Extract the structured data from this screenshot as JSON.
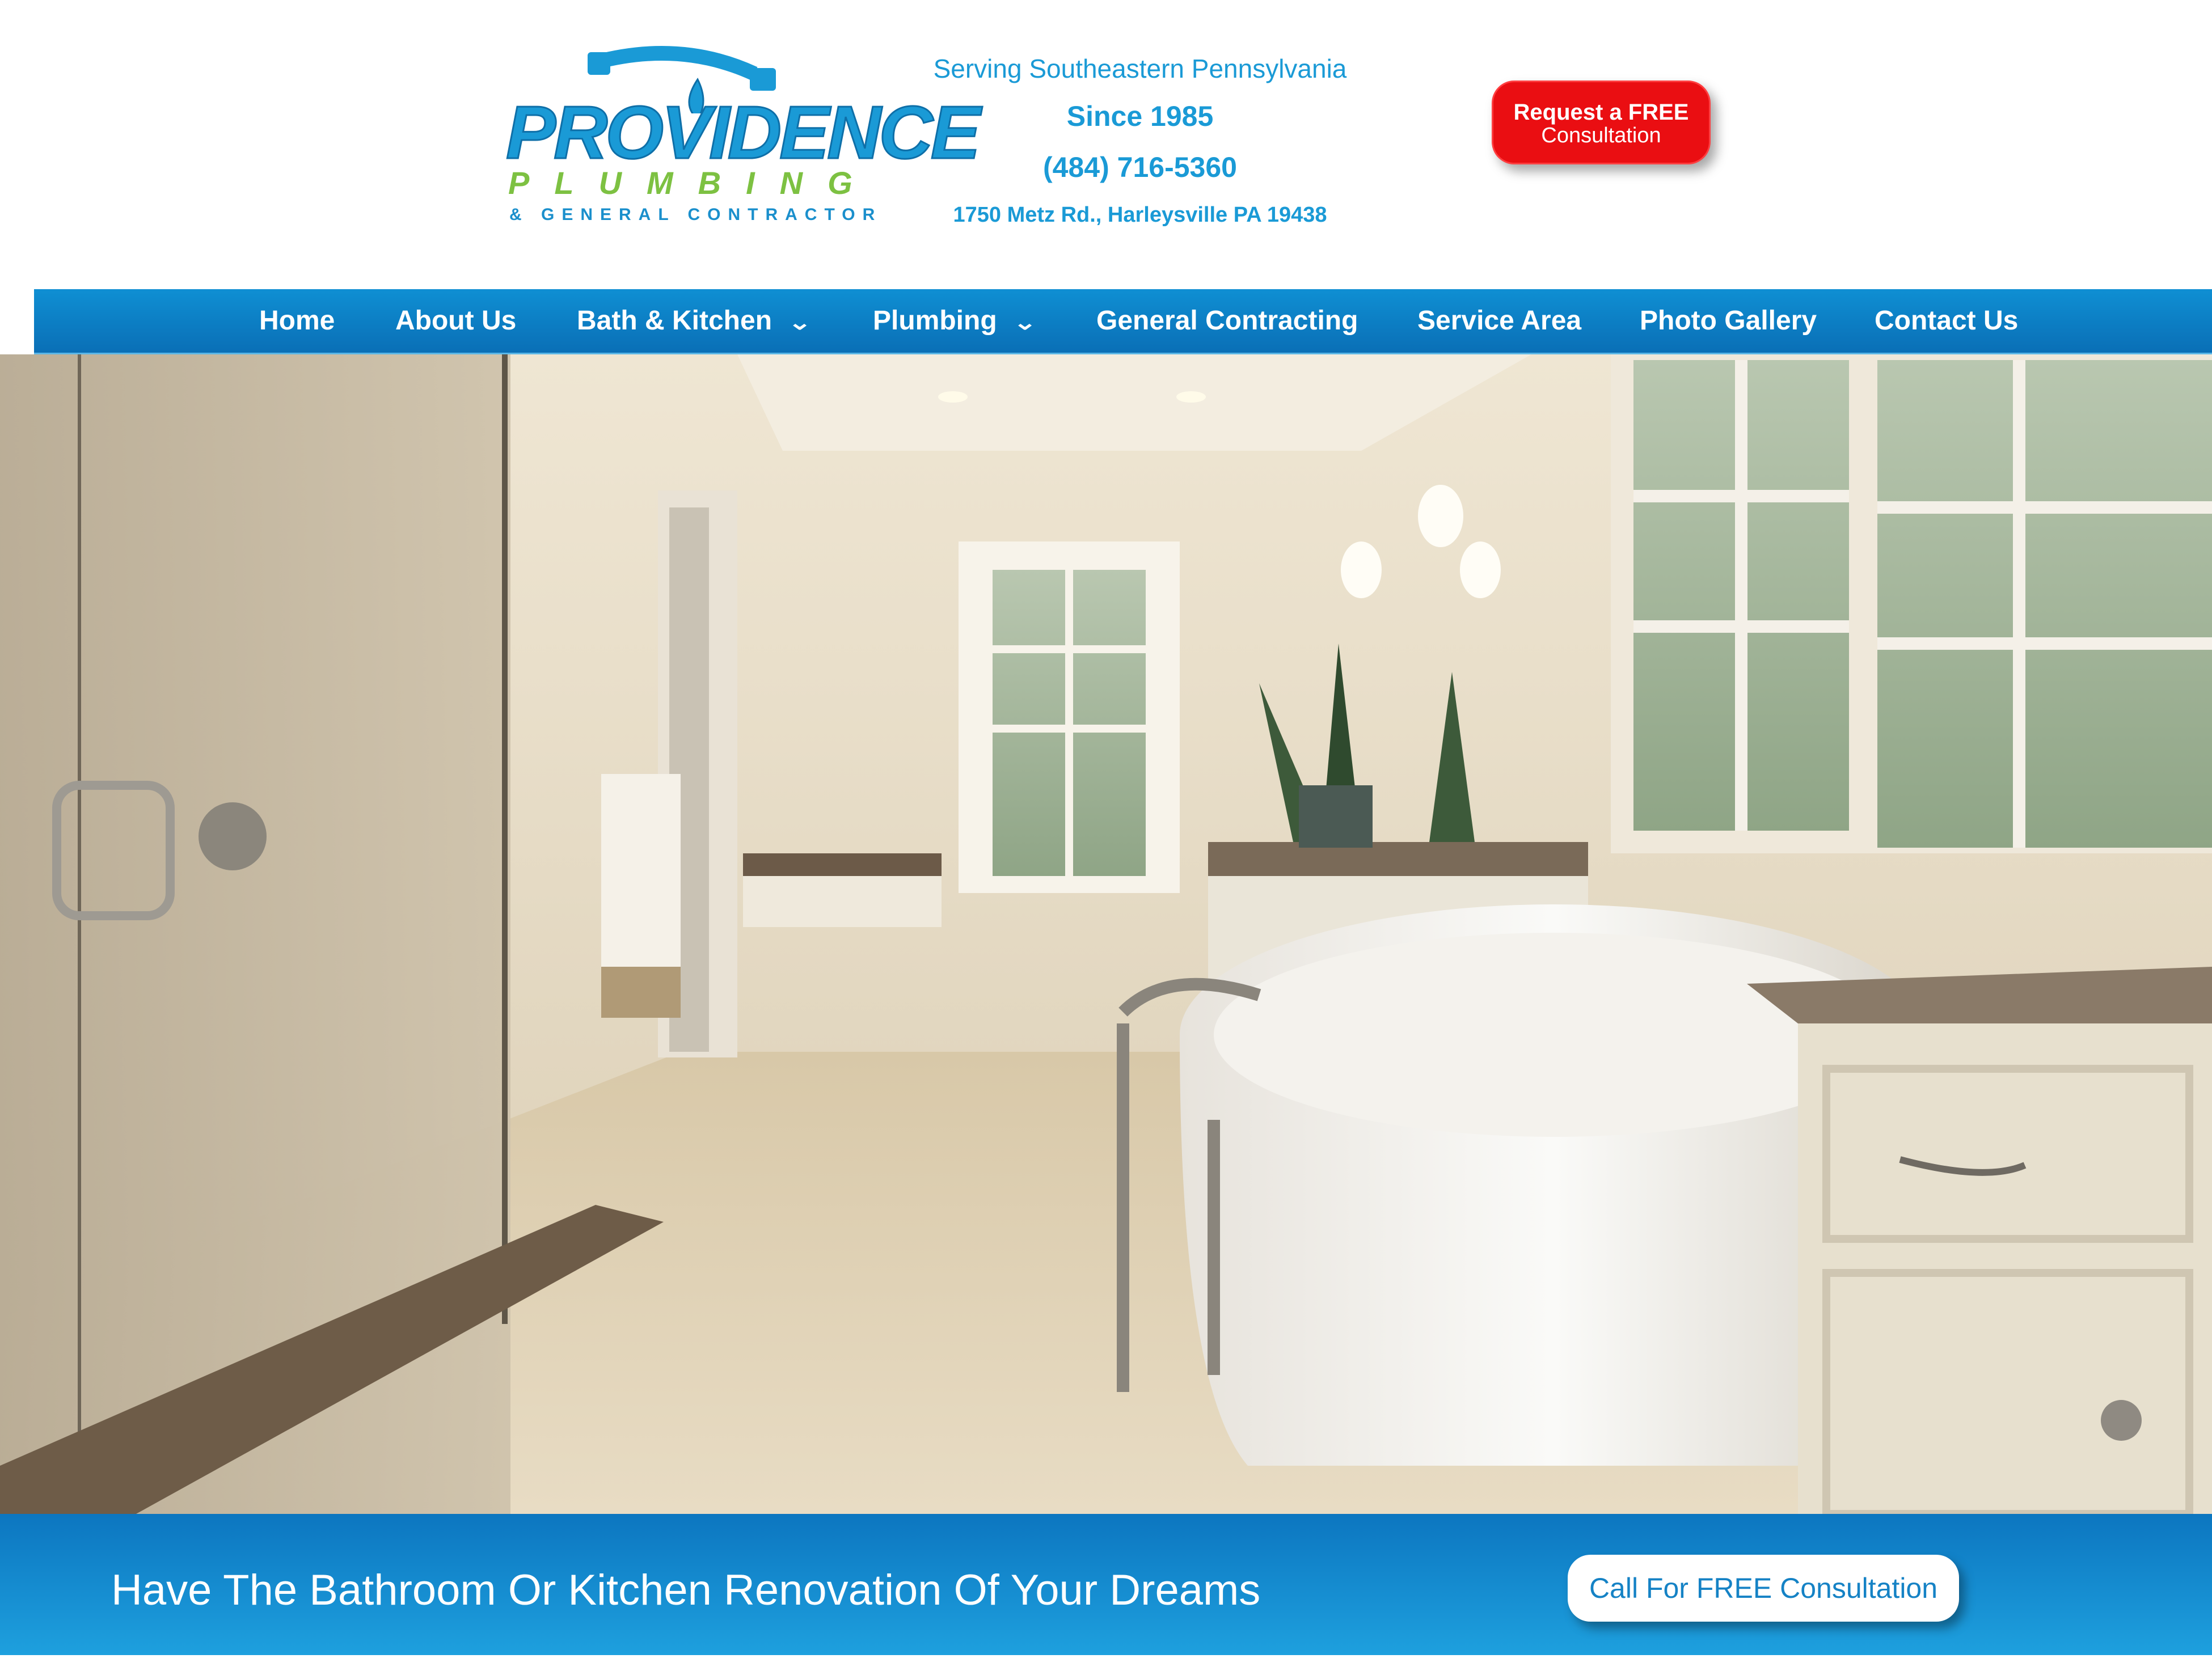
{
  "header": {
    "logo": {
      "word": "PROVIDENCE",
      "sub": "PLUMBING",
      "tagline": "& GENERAL CONTRACTOR"
    },
    "serving": "Serving Southeastern Pennsylvania",
    "since": "Since 1985",
    "phone": "(484) 716-5360",
    "address": "1750 Metz Rd., Harleysville PA 19438",
    "request_button": {
      "line1": "Request a FREE",
      "line2": "Consultation"
    }
  },
  "nav": {
    "items": [
      {
        "label": "Home",
        "dropdown": false
      },
      {
        "label": "About Us",
        "dropdown": false
      },
      {
        "label": "Bath & Kitchen",
        "dropdown": true
      },
      {
        "label": "Plumbing",
        "dropdown": true
      },
      {
        "label": "General Contracting",
        "dropdown": false
      },
      {
        "label": "Service Area",
        "dropdown": false
      },
      {
        "label": "Photo Gallery",
        "dropdown": false
      },
      {
        "label": "Contact Us",
        "dropdown": false
      }
    ],
    "dropdown_icon": "chevron-down-icon"
  },
  "hero": {
    "image": "bathroom-renovation-photo"
  },
  "cta": {
    "text": "Have The Bathroom Or Kitchen Renovation Of Your Dreams",
    "button": "Call For FREE Consultation"
  },
  "colors": {
    "brand_blue": "#1a9ad6",
    "brand_green": "#7dc142",
    "nav_blue": "#0f8fd3",
    "request_red": "#ea0e12"
  }
}
